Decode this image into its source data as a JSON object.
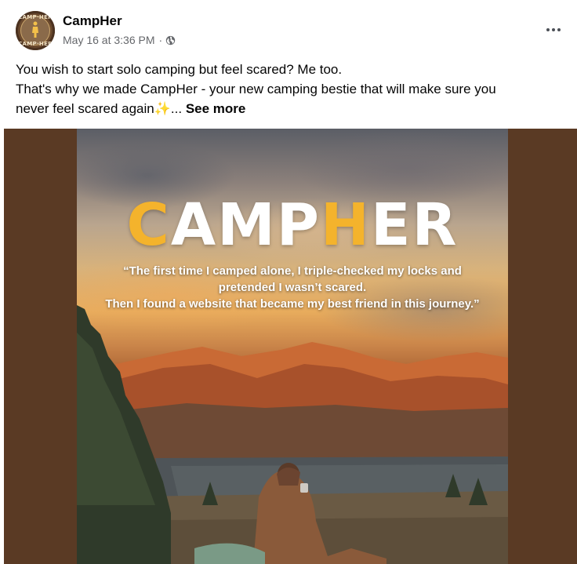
{
  "post": {
    "author": "CampHer",
    "timestamp": "May 16 at 3:36 PM",
    "separator": "·",
    "privacy_icon": "globe-icon",
    "more_icon": "more-options-icon",
    "avatar_text_top": "CAMP·HER",
    "avatar_text_bottom": "CAMP·HER",
    "text_line_1": "You wish to start solo camping but feel scared? Me too.",
    "text_line_2": "That's why we made CampHer - your new camping bestie that will make sure you",
    "text_line_3": "never feel scared again",
    "sparkle": "✨",
    "ellipsis": "...",
    "see_more": "See more"
  },
  "image": {
    "title_part_1": "CAMP",
    "title_part_2": "H",
    "title_part_3": "ER",
    "quote_line_1": "“The first time I camped alone, I triple-checked my locks and",
    "quote_line_2": "pretended I wasn’t scared.",
    "quote_line_3": "Then I found a website that became my best friend in this journey.”"
  },
  "colors": {
    "text_primary": "#050505",
    "text_secondary": "#65676b",
    "media_background": "#5a3a24",
    "title_white": "#ffffff",
    "title_accent": "#f4b32c"
  }
}
